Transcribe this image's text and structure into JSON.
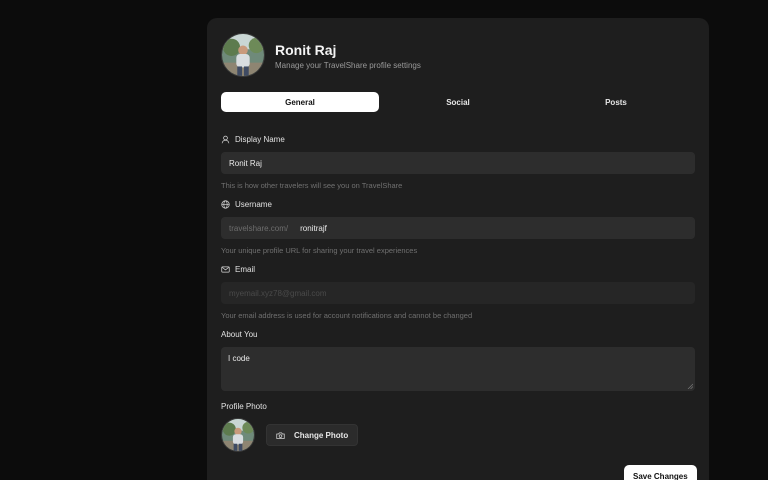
{
  "profile": {
    "name": "Ronit Raj",
    "subtitle": "Manage your TravelShare profile settings"
  },
  "tabs": [
    {
      "label": "General",
      "active": true
    },
    {
      "label": "Social",
      "active": false
    },
    {
      "label": "Posts",
      "active": false
    }
  ],
  "display_name": {
    "label": "Display Name",
    "icon": "user-icon",
    "value": "Ronit Raj",
    "help": "This is how other travelers will see you on TravelShare"
  },
  "username": {
    "label": "Username",
    "icon": "globe-icon",
    "prefix": "travelshare.com/",
    "value": "ronitrajf",
    "help": "Your unique profile URL for sharing your travel experiences"
  },
  "email": {
    "label": "Email",
    "icon": "mail-icon",
    "value": "myemail.xyz78@gmail.com",
    "help": "Your email address is used for account notifications and cannot be changed"
  },
  "about": {
    "label": "About You",
    "value": "I code"
  },
  "profile_photo": {
    "label": "Profile Photo",
    "button_label": "Change Photo",
    "button_icon": "camera-icon"
  },
  "save_label": "Save Changes",
  "colors": {
    "background": "#0c0c0c",
    "card": "#1e1e1e",
    "input": "#2d2d2d",
    "accent": "#ffffff"
  }
}
